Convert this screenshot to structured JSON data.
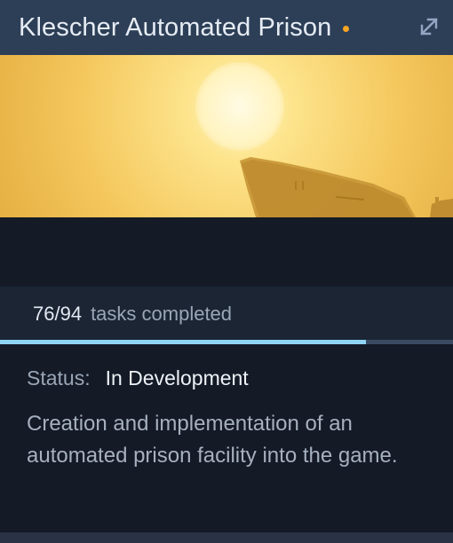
{
  "card": {
    "title": "Klescher Automated Prison",
    "status_dot_color": "#f5a623",
    "expand_icon": "expand-arrow-icon",
    "banner_image": "sunset-ship-silhouette",
    "progress": {
      "count": "76/94",
      "label": "tasks completed",
      "completed": 76,
      "total": 94,
      "fill_color": "#8fd3f2",
      "track_color": "#3a4a62"
    },
    "status": {
      "label": "Status:",
      "value": "In Development"
    },
    "description": "Creation and implementation of an automated prison facility into the game."
  }
}
